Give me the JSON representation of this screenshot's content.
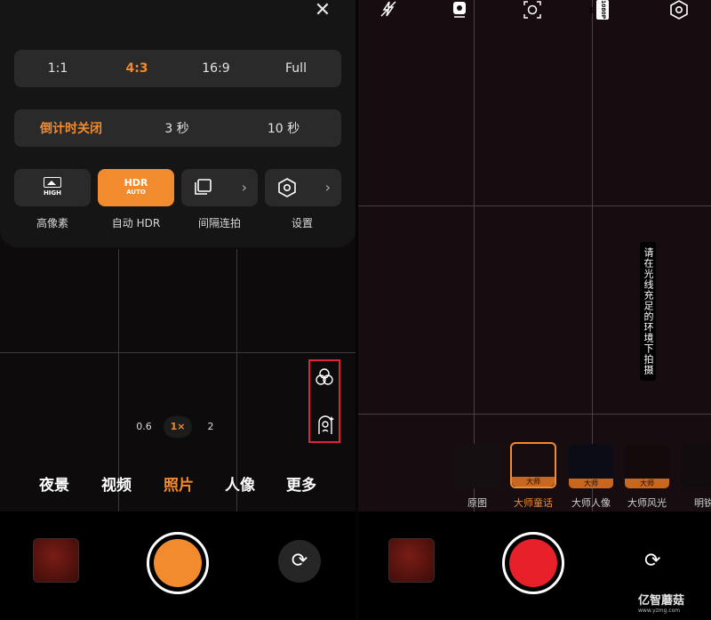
{
  "left_screen": {
    "aspect_ratios": [
      "1:1",
      "4:3",
      "16:9",
      "Full"
    ],
    "aspect_active": "4:3",
    "timer_options": [
      "倒计时关闭",
      "3 秒",
      "10 秒"
    ],
    "timer_active": "倒计时关闭",
    "tiles": [
      {
        "label": "高像素",
        "icon_text": "HIGH",
        "icon": "high-res-icon"
      },
      {
        "label": "自动 HDR",
        "icon_text_top": "HDR",
        "icon_text_bottom": "AUTO",
        "icon": "hdr-auto-icon",
        "active": true
      },
      {
        "label": "间隔连拍",
        "icon": "burst-icon",
        "chevron": "›"
      },
      {
        "label": "设置",
        "icon": "settings-icon",
        "chevron": "›"
      }
    ],
    "zoom_levels": [
      "0.6",
      "1×",
      "2"
    ],
    "zoom_active": "1×",
    "modes": [
      "夜景",
      "视频",
      "照片",
      "人像",
      "更多"
    ],
    "mode_active": "照片",
    "side_icons": [
      "filter-circles-icon",
      "portrait-retouch-icon"
    ],
    "shutter_color": "#f28a2e"
  },
  "right_screen": {
    "top_icons": [
      "flash-off-icon",
      "motion-photo-icon",
      "ai-scene-icon",
      "video-resolution-icon",
      "settings-icon"
    ],
    "resolution_text": "1080P 30",
    "tip": "请在光线充足的环境下拍摄",
    "filters": [
      {
        "label": "原图",
        "badge": ""
      },
      {
        "label": "大师童话",
        "badge": "大师",
        "active": true
      },
      {
        "label": "大师人像",
        "badge": "大师"
      },
      {
        "label": "大师风光",
        "badge": "大师"
      },
      {
        "label": "明锐",
        "badge": ""
      }
    ],
    "shutter_color": "#e8202a",
    "watermark": "亿智蘑菇",
    "watermark_url": "www.yzmg.com"
  },
  "colors": {
    "accent": "#f28a2e",
    "highlight_box": "#e0223a"
  }
}
